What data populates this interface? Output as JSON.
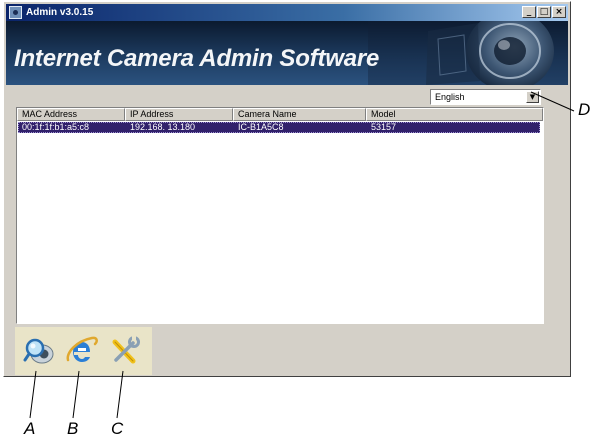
{
  "window": {
    "title": "Admin v3.0.15",
    "minimize_label": "_",
    "maximize_label": "□",
    "close_label": "×"
  },
  "banner": {
    "title": "Internet Camera Admin Software"
  },
  "language": {
    "selected": "English",
    "arrow": "▼"
  },
  "table": {
    "columns": [
      "MAC Address",
      "IP Address",
      "Camera Name",
      "Model"
    ],
    "rows": [
      {
        "mac": "00:1f:1f:b1:a5:c8",
        "ip": "192.168. 13.180",
        "name": "IC-B1A5C8",
        "model": "53157"
      }
    ]
  },
  "toolbar": {
    "icons": [
      "search-camera-icon",
      "internet-explorer-icon",
      "tools-icon"
    ]
  },
  "callouts": {
    "a": "A",
    "b": "B",
    "c": "C",
    "d": "D"
  }
}
